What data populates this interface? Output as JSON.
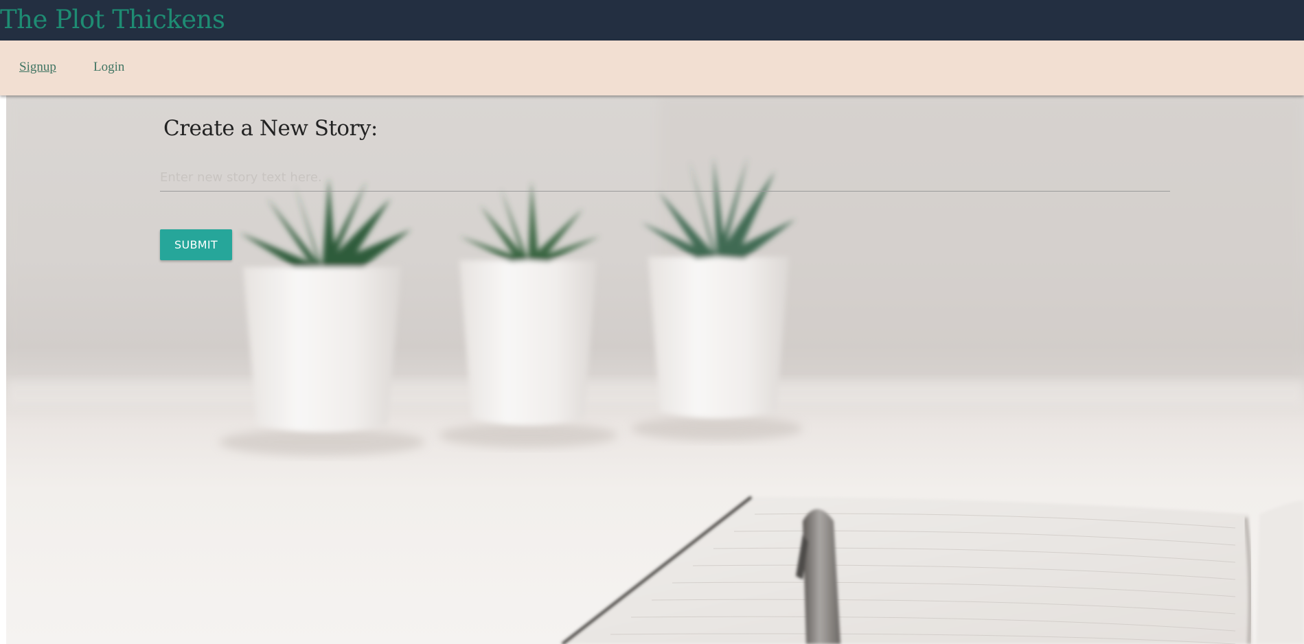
{
  "app": {
    "title": "The Plot Thickens",
    "brand_color": "#1e8c73",
    "header_bg": "#232f41",
    "nav_bg": "#f2dfd2"
  },
  "nav": {
    "items": [
      {
        "label": "Signup",
        "active": true
      },
      {
        "label": "Login",
        "active": false
      }
    ]
  },
  "form": {
    "heading": "Create a New Story:",
    "story_input": {
      "placeholder": "Enter new story text here.",
      "value": ""
    },
    "submit_label": "SUBMIT",
    "submit_color": "#26a69a"
  },
  "background": {
    "description_icon": "potted-plants-notebook-photo"
  }
}
